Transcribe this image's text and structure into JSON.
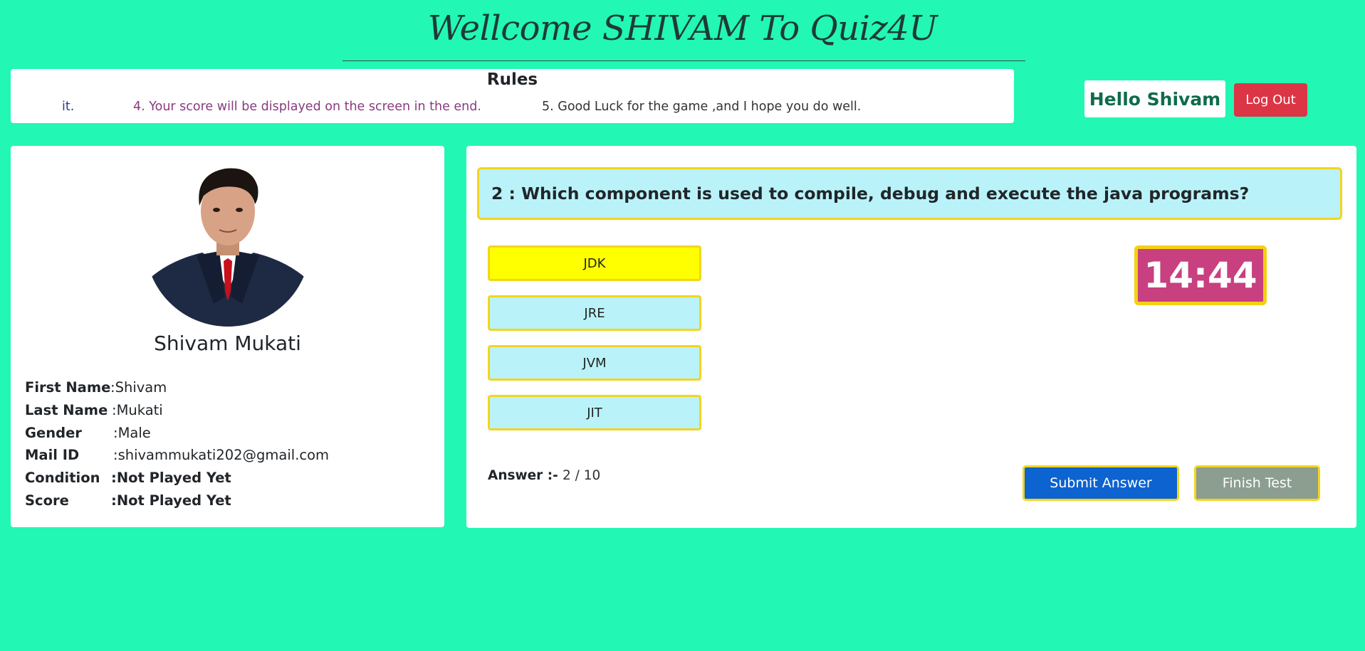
{
  "header": {
    "title": "Wellcome SHIVAM To Quiz4U"
  },
  "rules": {
    "heading": "Rules",
    "lines": [
      "it.",
      "4. Your score will be displayed on the screen in the end.",
      "5. Good Luck for the game ,and I hope you do well."
    ]
  },
  "user_menu": {
    "greeting": "Hello Shivam",
    "logout_label": "Log Out"
  },
  "profile": {
    "name": "Shivam Mukati",
    "details": [
      {
        "label": "First Name",
        "value": "Shivam"
      },
      {
        "label": "Last Name",
        "value": "Mukati"
      },
      {
        "label": "Gender",
        "value": "Male"
      },
      {
        "label": "Mail ID",
        "value": "shivammukati202@gmail.com"
      },
      {
        "label": "Condition",
        "value": "Not Played Yet"
      },
      {
        "label": "Score",
        "value": "Not Played Yet"
      }
    ]
  },
  "quiz": {
    "question": "2 : Which component is used to compile, debug and execute the java programs?",
    "options": [
      "JDK",
      "JRE",
      "JVM",
      "JIT"
    ],
    "selected_option": "JDK",
    "timer": "14:44",
    "answer_label": "Answer :-",
    "answer_progress": "2 / 10",
    "submit_label": "Submit Answer",
    "finish_label": "Finish Test"
  },
  "colors": {
    "background": "#23f7b4",
    "accent_yellow": "#f2d51f",
    "timer": "#c8407f",
    "logout": "#dc3545",
    "submit": "#0d63cf",
    "finish": "#8c9e8f",
    "selected_option": "#ffff00",
    "option": "#b9f3f9"
  }
}
